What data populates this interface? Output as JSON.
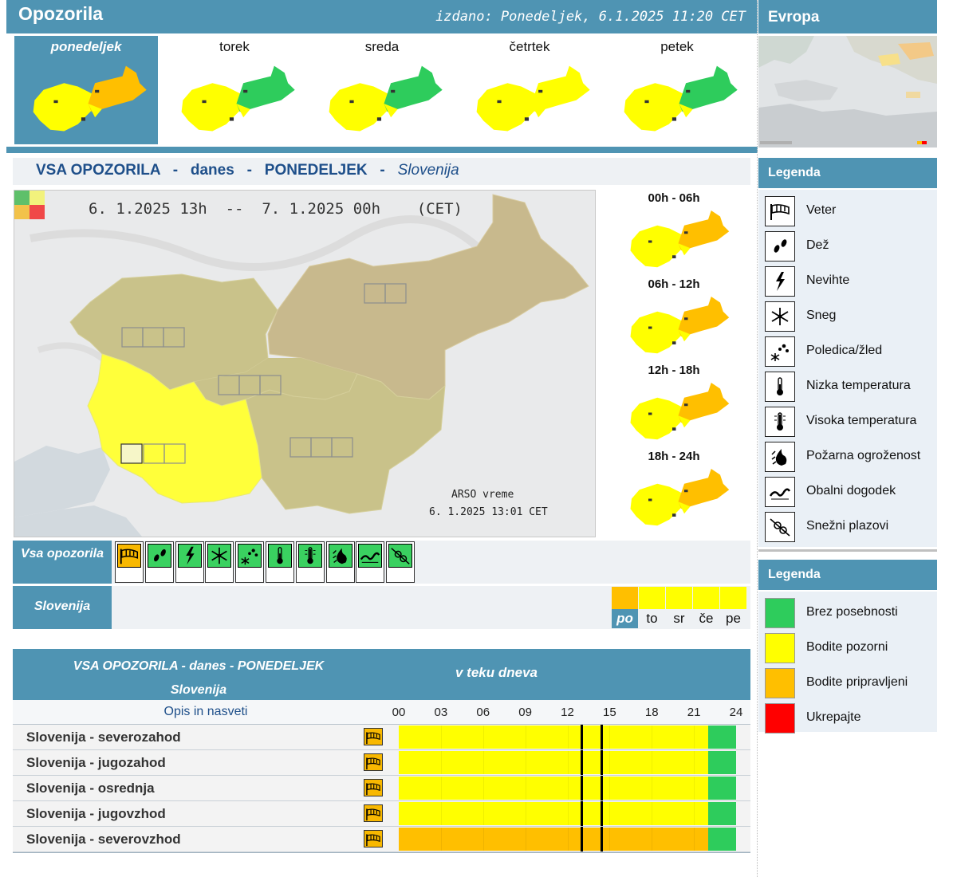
{
  "header": {
    "title": "Opozorila",
    "issued": "izdano: Ponedeljek, 6.1.2025 11:20 CET",
    "europe_title": "Evropa"
  },
  "days": [
    {
      "label": "ponedeljek",
      "selected": true,
      "left": "yellow",
      "right": "orange"
    },
    {
      "label": "torek",
      "selected": false,
      "left": "yellow",
      "right": "green"
    },
    {
      "label": "sreda",
      "selected": false,
      "left": "yellow",
      "right": "green"
    },
    {
      "label": "četrtek",
      "selected": false,
      "left": "yellow",
      "right": "yellow"
    },
    {
      "label": "petek",
      "selected": false,
      "left": "yellow",
      "right": "green"
    }
  ],
  "main": {
    "title_prefix": "VSA OPOZORILA   -   danes   -   PONEDELJEK   -   ",
    "title_region": "Slovenija",
    "map_time": "6. 1.2025 13h  --  7. 1.2025 00h    (CET)",
    "map_source": "ARSO vreme",
    "map_source_time": "6. 1.2025  13:01 CET"
  },
  "slots": [
    {
      "label": "00h - 06h"
    },
    {
      "label": "06h - 12h"
    },
    {
      "label": "12h - 18h"
    },
    {
      "label": "18h - 24h"
    }
  ],
  "types_row": {
    "label": "Vsa opozorila",
    "icons": [
      {
        "icon": "wind-icon",
        "active": true
      },
      {
        "icon": "rain-icon",
        "active": false
      },
      {
        "icon": "thunderstorm-icon",
        "active": false
      },
      {
        "icon": "snow-icon",
        "active": false
      },
      {
        "icon": "ice-icon",
        "active": false
      },
      {
        "icon": "low-temperature-icon",
        "active": false
      },
      {
        "icon": "high-temperature-icon",
        "active": false
      },
      {
        "icon": "fire-risk-icon",
        "active": false
      },
      {
        "icon": "coastal-event-icon",
        "active": false
      },
      {
        "icon": "avalanche-icon",
        "active": false
      }
    ]
  },
  "region_row": {
    "label": "Slovenija",
    "days": [
      {
        "label": "po",
        "level": "orange",
        "selected": true
      },
      {
        "label": "to",
        "level": "yellow",
        "selected": false
      },
      {
        "label": "sr",
        "level": "yellow",
        "selected": false
      },
      {
        "label": "če",
        "level": "yellow",
        "selected": false
      },
      {
        "label": "pe",
        "level": "yellow",
        "selected": false
      }
    ]
  },
  "timeline": {
    "title": "VSA OPOZORILA - danes - PONEDELJEK",
    "subtitle": "Slovenija",
    "during_day": "v teku dneva",
    "desc_header": "Opis in nasveti",
    "hours": [
      "00",
      "03",
      "06",
      "09",
      "12",
      "15",
      "18",
      "21",
      "24"
    ],
    "rows": [
      {
        "name": "Slovenija - severozahod",
        "level": "yellow",
        "green_from_hour": 22
      },
      {
        "name": "Slovenija - jugozahod",
        "level": "yellow",
        "green_from_hour": 22
      },
      {
        "name": "Slovenija - osrednja",
        "level": "yellow",
        "green_from_hour": 22
      },
      {
        "name": "Slovenija - jugovzhod",
        "level": "yellow",
        "green_from_hour": 22
      },
      {
        "name": "Slovenija - severovzhod",
        "level": "orange",
        "green_from_hour": 22
      }
    ],
    "markers_hour": [
      13,
      14.4
    ]
  },
  "legend_types": {
    "title": "Legenda",
    "items": [
      {
        "icon": "wind-icon",
        "label": "Veter"
      },
      {
        "icon": "rain-icon",
        "label": "Dež"
      },
      {
        "icon": "thunderstorm-icon",
        "label": "Nevihte"
      },
      {
        "icon": "snow-icon",
        "label": "Sneg"
      },
      {
        "icon": "ice-icon",
        "label": "Poledica/žled"
      },
      {
        "icon": "low-temperature-icon",
        "label": "Nizka temperatura"
      },
      {
        "icon": "high-temperature-icon",
        "label": "Visoka temperatura"
      },
      {
        "icon": "fire-risk-icon",
        "label": "Požarna ogroženost"
      },
      {
        "icon": "coastal-event-icon",
        "label": "Obalni dogodek"
      },
      {
        "icon": "avalanche-icon",
        "label": "Snežni plazovi"
      }
    ]
  },
  "legend_levels": {
    "title": "Legenda",
    "items": [
      {
        "label": "Brez posebnosti",
        "color": "#2ecc5c"
      },
      {
        "label": "Bodite pozorni",
        "color": "#ffff00"
      },
      {
        "label": "Bodite pripravljeni",
        "color": "#ffbf00"
      },
      {
        "label": "Ukrepajte",
        "color": "#ff0000"
      }
    ]
  },
  "colors": {
    "accent": "#4f94b3",
    "green": "#2ecc5c",
    "yellow": "#ffff00",
    "orange": "#ffbf00",
    "red": "#ff0000"
  }
}
